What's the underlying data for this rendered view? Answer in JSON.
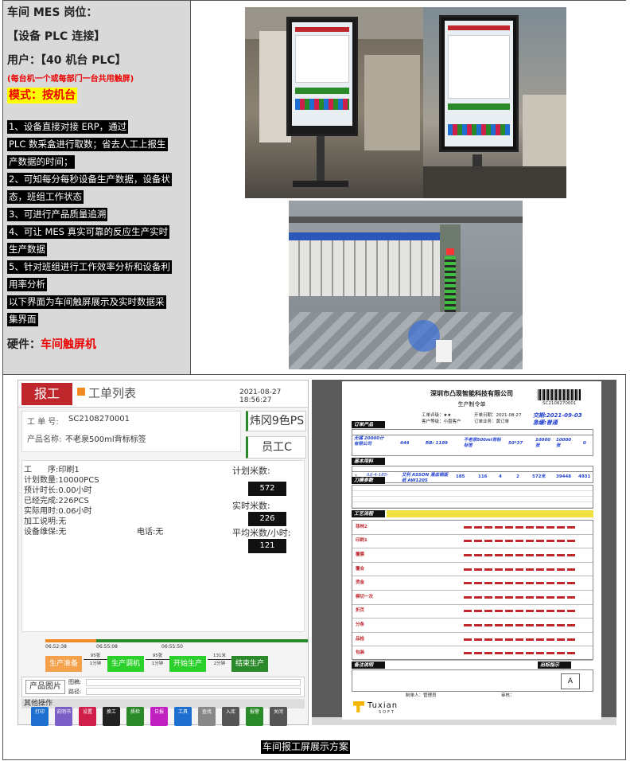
{
  "left_panel": {
    "line1": "车间 MES 岗位：",
    "line2": "【设备 PLC 连接】",
    "line3": "用户：【40 机台 PLC】",
    "note": "(每台机一个或每部门一台共用触屏)",
    "mode": "模式：按机台",
    "desc": [
      "1、设备直接对接 ERP，通过",
      "PLC 数采盒进行取数；省去人工上报生",
      "产数据的时间；",
      "2、可知每分每秒设备生产数据，设备状",
      "态，班组工作状态",
      "3、可进行产品质量追溯",
      "4、可让 MES 真实可靠的反应生产实时",
      "生产数据",
      "5、针对班组进行工作效率分析和设备利",
      "用率分析",
      "以下界面为车间触屏展示及实时数据采",
      "集界面"
    ],
    "hardware_label": "硬件：",
    "hardware_value": "车间触屏机"
  },
  "mes": {
    "tab_active": "报工",
    "tab_other": "工单列表",
    "datetime": "2021-08-27 18:56:27",
    "order_label": "工 单 号:",
    "order_no": "SC2108270001",
    "product_label": "产品名称:",
    "product_name": "不老泉500ml背标标签",
    "machine": "炜冈9色PS",
    "operator": "员工C",
    "process_label": "工　　序:",
    "process": "印刷1",
    "plan_qty_label": "计划数量:",
    "plan_qty": "10000PCS",
    "est_time_label": "预计时长:",
    "est_time": "0.00小时",
    "done_label": "已经完成:",
    "done": "226PCS",
    "actual_time_label": "实际用时:",
    "actual_time": "0.06小时",
    "process_note_label": "加工说明:",
    "process_note": "无",
    "maint_label": "设备维保:",
    "maint": "无",
    "phone_label": "电话:",
    "phone": "无",
    "plan_m_label": "计划米数:",
    "plan_m": "572",
    "actual_m_label": "实时米数:",
    "actual_m": "226",
    "avg_label": "平均米数/小时:",
    "avg": "121",
    "timeline": [
      "06:52:38",
      "06:55:08",
      "06:55:50"
    ],
    "phases": [
      "生产准备",
      "生产调机",
      "开始生产",
      "结束生产"
    ],
    "phase_gaps": [
      {
        "top": "95张",
        "bottom": "1分钟"
      },
      {
        "top": "95张",
        "bottom": "1分钟"
      },
      {
        "top": "131米",
        "bottom": "2分钟"
      }
    ],
    "image_label": "产品图片",
    "drawing_label": "图稿:",
    "path_label": "路径:",
    "other_ops": "其他操作",
    "tools": [
      "打印",
      "说明书",
      "设置",
      "换工",
      "质检",
      "日报",
      "工具",
      "查找",
      "入库",
      "报警",
      "关闭"
    ],
    "tool_colors": [
      "#1e6fd0",
      "#7b5fc7",
      "#d01e4a",
      "#222",
      "#2a8a2a",
      "#c020c0",
      "#1e6fd0",
      "#888",
      "#555",
      "#2a8a2a",
      "#555"
    ]
  },
  "doc": {
    "company": "深圳市凸现智能科技有限公司",
    "title": "生产制令单",
    "barcode_text": "SC2108270001",
    "order_no_label": "工单评级：★★",
    "issue_date": "开单日期：2021-08-27",
    "delivery": "交期:2021-09-03",
    "urgency": "急缓:普通",
    "customer_grade": "客户等级：小盘客户",
    "salesman": "订单业务：黄订单",
    "sections": [
      "订单产品",
      "基本用料",
      "刀模参数",
      "工艺流程",
      "备注说明",
      "出标指示"
    ],
    "product_row": [
      "无福 20000计 有限公司",
      "444",
      "RB: 1199",
      "不老泉500ml背标标签",
      "50*37",
      "10000张",
      "10000张",
      "0"
    ],
    "material_row": [
      "1",
      "IUJ-4-185-0003",
      "艾利 ASSON 黑底铜版纸 AW1205",
      "185",
      "116",
      "4",
      "2",
      "572米",
      "39448",
      "4931"
    ],
    "process_steps": [
      "菲林2",
      "印刷1",
      "覆膜",
      "覆合",
      "烫金",
      "模切一次",
      "折页",
      "分条",
      "品检",
      "包装"
    ],
    "footer_left": "制单人：管理员",
    "footer_right": "审核：",
    "brand": "Tuxian",
    "brand_sub": "SOFT"
  },
  "caption": "车间报工屏展示方案"
}
